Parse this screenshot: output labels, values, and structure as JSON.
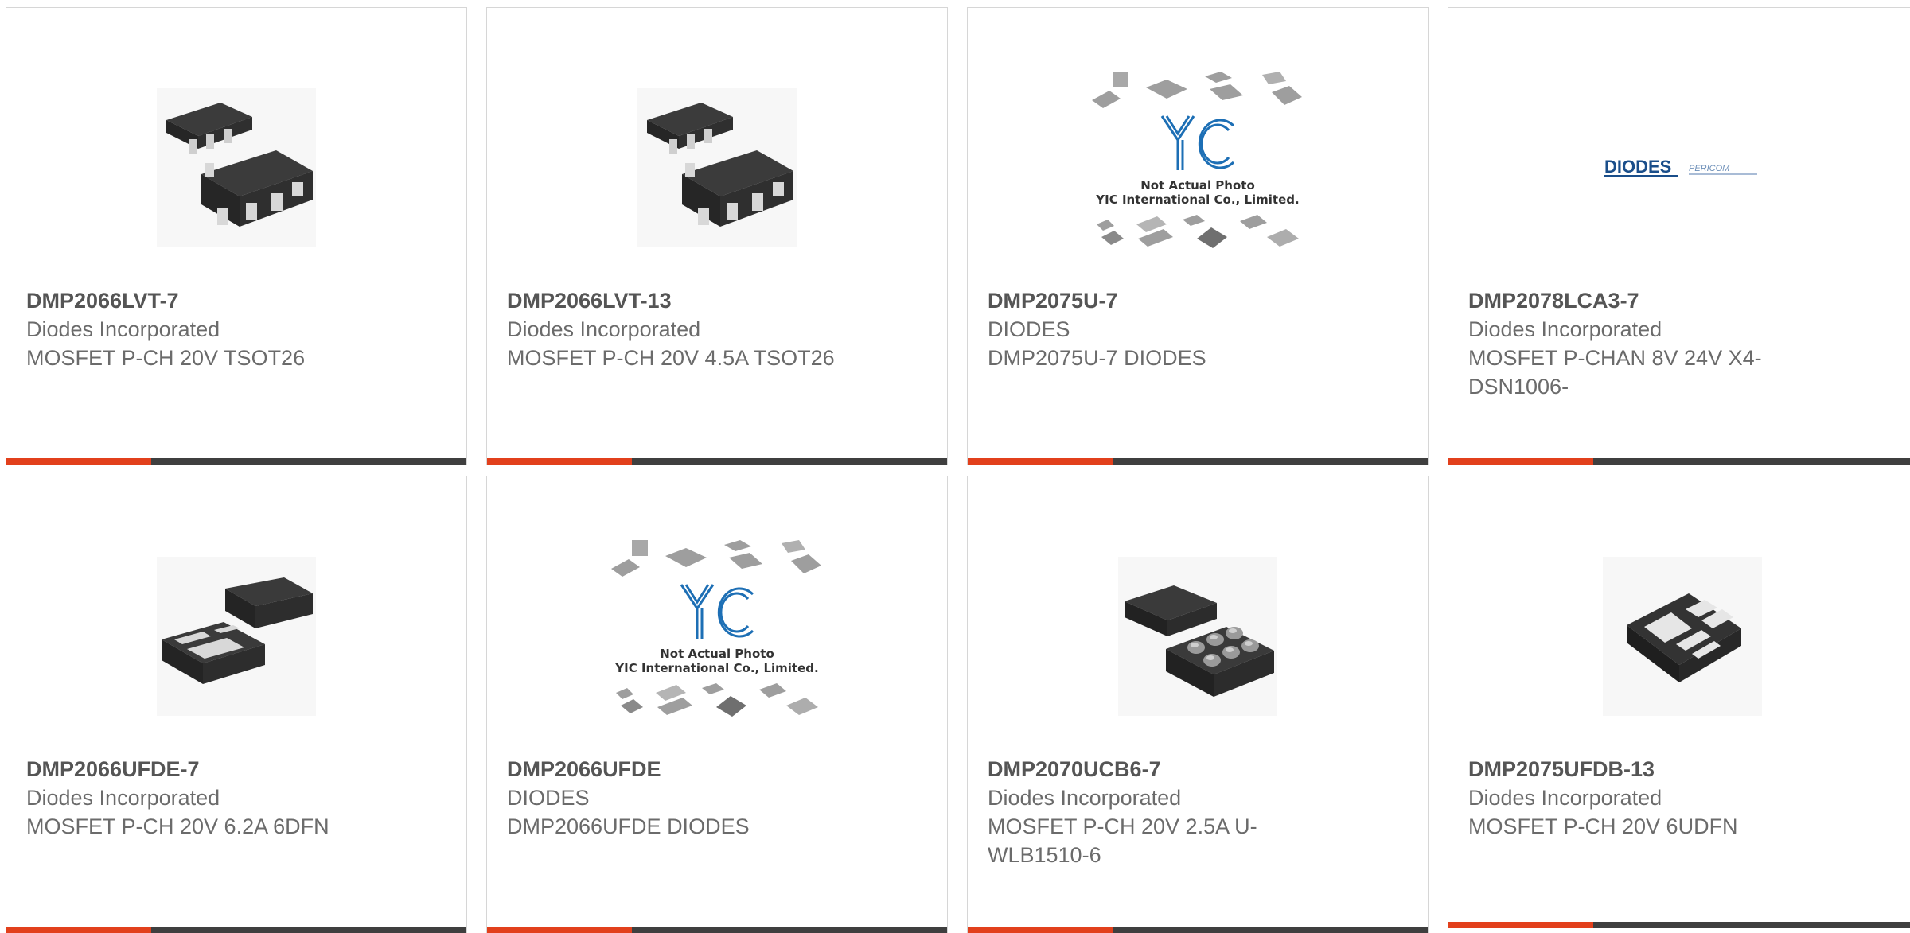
{
  "products": [
    {
      "part": "DMP2066LVT-7",
      "maker": "Diodes Incorporated",
      "desc": "MOSFET P-CH 20V TSOT26",
      "image": "tsot26-package-photo"
    },
    {
      "part": "DMP2066LVT-13",
      "maker": "Diodes Incorporated",
      "desc": "MOSFET P-CH 20V 4.5A TSOT26",
      "image": "tsot26-package-photo"
    },
    {
      "part": "DMP2075U-7",
      "maker": "DIODES",
      "desc": "DMP2075U-7 DIODES",
      "image": "yic-placeholder-photo"
    },
    {
      "part": "DMP2078LCA3-7",
      "maker": "Diodes Incorporated",
      "desc": "MOSFET P-CHAN 8V 24V X4-DSN1006-",
      "image": "diodes-pericom-logo"
    },
    {
      "part": "DMP2066UFDE-7",
      "maker": "Diodes Incorporated",
      "desc": "MOSFET P-CH 20V 6.2A 6DFN",
      "image": "dfn-package-photo"
    },
    {
      "part": "DMP2066UFDE",
      "maker": "DIODES",
      "desc": "DMP2066UFDE DIODES",
      "image": "yic-placeholder-photo"
    },
    {
      "part": "DMP2070UCB6-7",
      "maker": "Diodes Incorporated",
      "desc": "MOSFET P-CH 20V 2.5A U-WLB1510-6",
      "image": "wlb-package-photo"
    },
    {
      "part": "DMP2075UFDB-13",
      "maker": "Diodes Incorporated",
      "desc": "MOSFET P-CH 20V 6UDFN",
      "image": "udfn-package-photo"
    }
  ],
  "placeholder": {
    "line1": "Not Actual Photo",
    "line2": "YIC International Co., Limited.",
    "logo": "YIC"
  },
  "logo_text": {
    "diodes": "DIODES",
    "pericom": "PERICOM"
  },
  "colors": {
    "accent": "#e2401c",
    "bar": "#3f3f3f",
    "border": "#d6d6d6",
    "yic_blue": "#1d6fb5"
  }
}
